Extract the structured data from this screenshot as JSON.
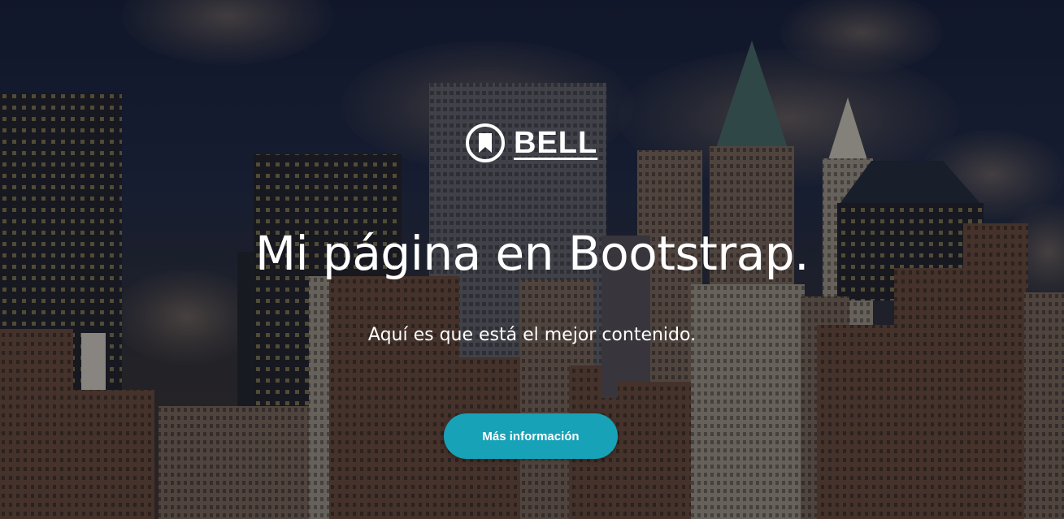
{
  "brand": {
    "name": "BELL",
    "icon": "bookmark-circle-icon"
  },
  "hero": {
    "title": "Mi página en Bootstrap.",
    "subtitle": "Aquí es que está el mejor contenido.",
    "button_label": "Más información"
  },
  "colors": {
    "button_bg": "#17a2b8",
    "text": "#ffffff",
    "sky_top": "#141b30"
  }
}
